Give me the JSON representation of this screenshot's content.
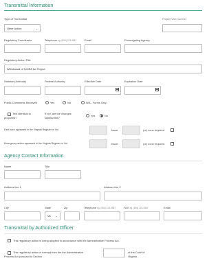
{
  "sections": {
    "transmittal_information": "Transmittal Information",
    "agency_contact_information": "Agency Contact Information",
    "transmittal_by_authorized_officer": "Transmittal by Authorized Officer"
  },
  "transmittal": {
    "type_label": "Type of Transmittal",
    "type_value": "Other Action",
    "project_number_label": "Project VAC number",
    "coordinator_label": "Regulatory Coordinator",
    "telephone_label": "Telephone",
    "telephone_placeholder": "eg. (804) 123-4567",
    "email_label": "Email",
    "promulgating_agency_label": "Promulgating Agency",
    "action_title_label": "Regulatory Action Title",
    "action_title_value": "Withdrawal of NOIRA for Project",
    "statutory_authority_label": "Statutory Authority",
    "federal_authority_label": "Federal Authority",
    "effective_date_label": "Effective Date",
    "expiration_date_label": "Expiration Date",
    "public_comments_label": "Public Comments Received",
    "yes_label": "Yes",
    "no_label": "No",
    "na_label": "N/A - Forms Only",
    "text_identical_label_1": "Text identical to",
    "text_identical_label_2": "proposed?",
    "if_not_label_1": "If not, are the changes",
    "if_not_label_2": "substantive?",
    "fast_track_label": "Fast track appeared in the Virginia Register in Vol.",
    "issue_label": "Issue:",
    "none_required_label": "(or) none required",
    "emergency_label": "Emergency action appeared in the Virginia Register in Vol."
  },
  "contact": {
    "name_label": "Name",
    "title_label": "Title",
    "address1_label": "Address line 1",
    "address2_label": "Address line 2",
    "city_label": "City",
    "state_label": "State",
    "state_value": "VA",
    "zip_label": "Zip",
    "telephone_label": "Telephone",
    "telephone_placeholder": "eg. (804) 123-4567",
    "fax_label": "FAX",
    "fax_placeholder": "eg. (804) 123-4567",
    "email_label": "Email"
  },
  "officer": {
    "adopted_label": "This regulatory action is being adopted in accordance with the Administrative Process Act.",
    "exempt_label_1": "This regulatory action is exempt from the the Administrative",
    "exempt_label_2": "Process Act pursuant to Section",
    "code_label_1": "of the Code of",
    "code_label_2": "Virginia."
  },
  "icons": {
    "dropdown": "chevron-down-icon",
    "date": "calendar-icon"
  },
  "colors": {
    "accent": "#2e8b6e",
    "rule": "#3aa383",
    "disabled_field": "#e9e9e9"
  }
}
